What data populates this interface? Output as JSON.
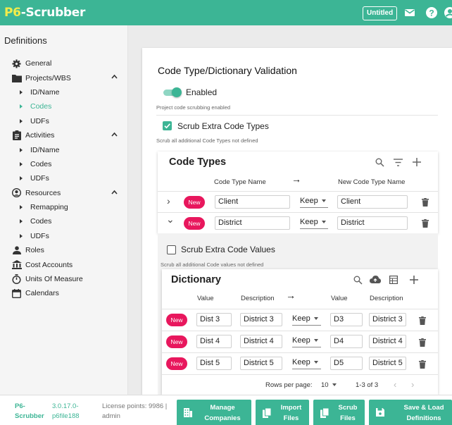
{
  "header": {
    "logo_p6": "P6",
    "logo_rest": "-Scrubber",
    "doc_name": "Untitled"
  },
  "sidebar": {
    "title": "Definitions",
    "items": [
      {
        "label": "General",
        "icon": "gear-icon",
        "level": 0
      },
      {
        "label": "Projects/WBS",
        "icon": "folder-icon",
        "level": 0,
        "expanded": true
      },
      {
        "label": "ID/Name",
        "level": 1
      },
      {
        "label": "Codes",
        "level": 1,
        "active": true
      },
      {
        "label": "UDFs",
        "level": 1
      },
      {
        "label": "Activities",
        "icon": "clipboard-icon",
        "level": 0,
        "expanded": true
      },
      {
        "label": "ID/Name",
        "level": 1
      },
      {
        "label": "Codes",
        "level": 1
      },
      {
        "label": "UDFs",
        "level": 1
      },
      {
        "label": "Resources",
        "icon": "account-circle-icon",
        "level": 0,
        "expanded": true
      },
      {
        "label": "Remapping",
        "level": 1
      },
      {
        "label": "Codes",
        "level": 1
      },
      {
        "label": "UDFs",
        "level": 1
      },
      {
        "label": "Roles",
        "icon": "person-icon",
        "level": 0
      },
      {
        "label": "Cost Accounts",
        "icon": "bank-icon",
        "level": 0
      },
      {
        "label": "Units Of Measure",
        "icon": "stopwatch-icon",
        "level": 0
      },
      {
        "label": "Calendars",
        "icon": "calendar-icon",
        "level": 0
      }
    ]
  },
  "main": {
    "title": "Code Type/Dictionary Validation",
    "enabled_label": "Enabled",
    "enabled_hint": "Project code scrubbing enabled",
    "scrub_types_label": "Scrub Extra Code Types",
    "scrub_types_hint": "Scrub all additional Code Types not defined",
    "code_types": {
      "title": "Code Types",
      "col_name": "Code Type Name",
      "col_arrow": "→",
      "col_new_name": "New Code Type Name",
      "rows": [
        {
          "expand_glyph": "›",
          "badge": "New",
          "name": "Client",
          "action": "Keep",
          "new_name": "Client"
        },
        {
          "expand_glyph": "⌄",
          "badge": "New",
          "name": "District",
          "action": "Keep",
          "new_name": "District"
        }
      ]
    },
    "scrub_values_label": "Scrub Extra Code Values",
    "scrub_values_hint": "Scrub all additional Code values not defined",
    "dictionary": {
      "title": "Dictionary",
      "col_value": "Value",
      "col_desc": "Description",
      "col_arrow": "→",
      "col_new_value": "Value",
      "col_new_desc": "Description",
      "rows": [
        {
          "badge": "New",
          "value": "Dist 3",
          "desc": "District 3",
          "action": "Keep",
          "new_value": "D3",
          "new_desc": "District 3"
        },
        {
          "badge": "New",
          "value": "Dist 4",
          "desc": "District 4",
          "action": "Keep",
          "new_value": "D4",
          "new_desc": "District 4"
        },
        {
          "badge": "New",
          "value": "Dist 5",
          "desc": "District 5",
          "action": "Keep",
          "new_value": "D5",
          "new_desc": "District 5"
        }
      ],
      "rows_per_page_label": "Rows per page:",
      "rows_per_page": "10",
      "range": "1-3 of 3"
    }
  },
  "footer": {
    "app_name_1": "P6-",
    "app_name_2": "Scrubber",
    "version": "3.0.17.0-",
    "file": "p6file188",
    "license": "License points: 9986 |",
    "user": "admin",
    "buttons": [
      {
        "line1": "Manage",
        "line2": "Companies",
        "icon": "building-icon"
      },
      {
        "line1": "Import",
        "line2": "Files",
        "icon": "file-copy-icon"
      },
      {
        "line1": "Scrub",
        "line2": "Files",
        "icon": "file-copy-icon"
      },
      {
        "line1": "Save & Load",
        "line2": "Definitions",
        "icon": "save-icon"
      }
    ]
  },
  "colors": {
    "brand": "#3cb595",
    "badge": "#e8175d",
    "logo_accent": "#f2ec4a"
  }
}
